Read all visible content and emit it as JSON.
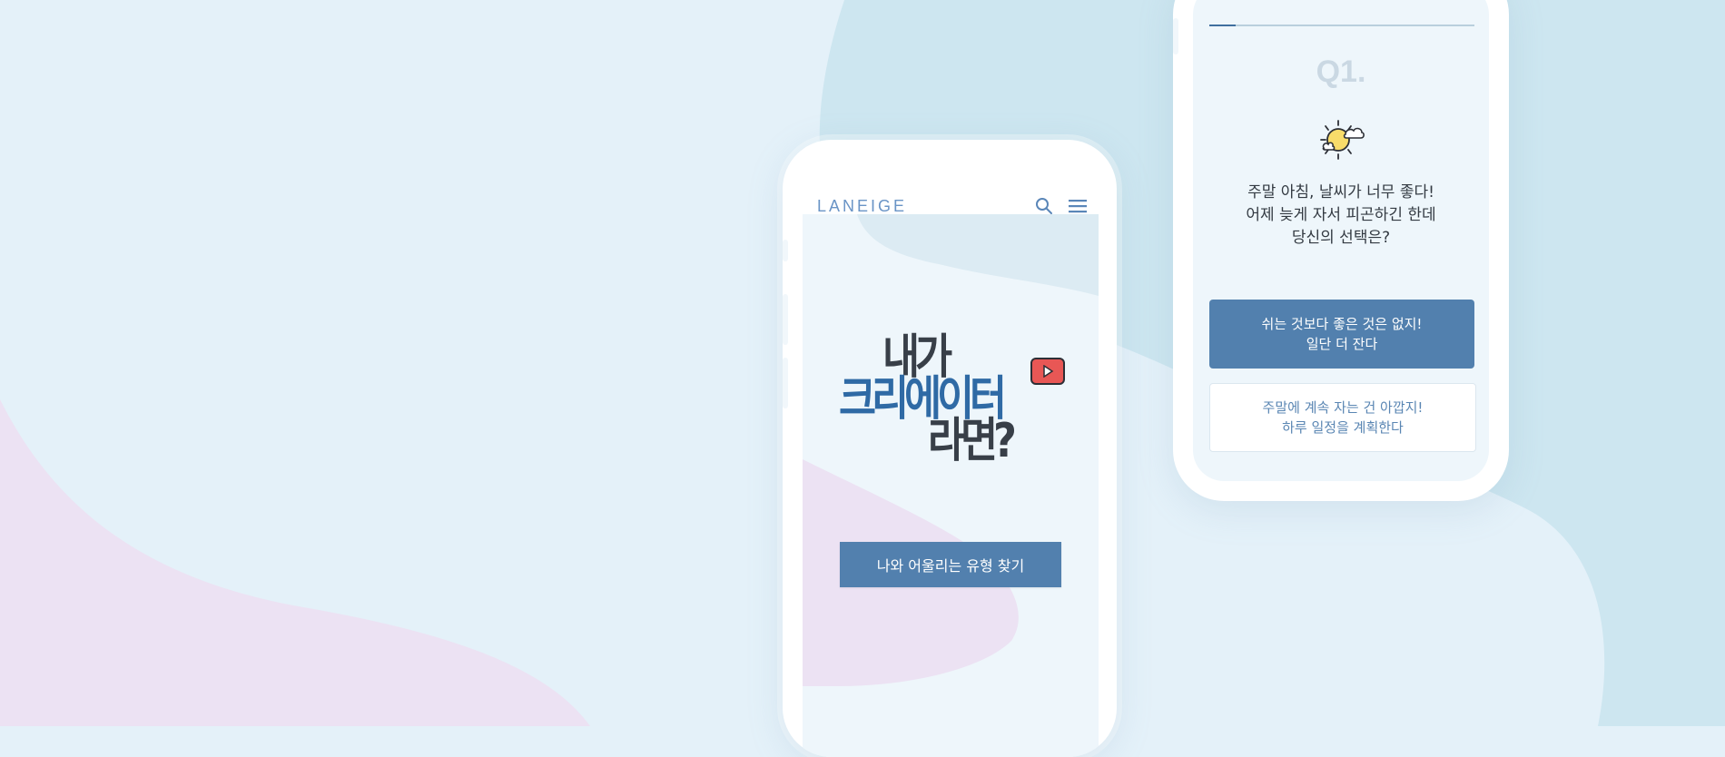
{
  "colors": {
    "background": "#e4f1f9",
    "blob_blue": "#cde6f0",
    "blob_pink": "#ece2f3",
    "accent": "#5280ae",
    "title_dark": "#383f48",
    "title_blue": "#2f6aa5"
  },
  "phone_intro": {
    "logo": "LANEIGE",
    "icons": [
      "search-icon",
      "menu-icon",
      "play-icon"
    ],
    "title_lines": [
      "내가",
      "크리에이터",
      "라면?"
    ],
    "cta_label": "나와 어울리는 유형 찾기"
  },
  "phone_quiz": {
    "progress": 0.1,
    "question_number": "Q1.",
    "icon": "sun-cloud-icon",
    "question_lines": [
      "주말 아침, 날씨가 너무 좋다!",
      "어제 늦게 자서 피곤하긴 한데",
      "당신의 선택은?"
    ],
    "answers": [
      {
        "lines": [
          "쉬는 것보다 좋은 것은 없지!",
          "일단 더 잔다"
        ]
      },
      {
        "lines": [
          "주말에 계속 자는 건 아깝지!",
          "하루 일정을 계획한다"
        ]
      }
    ]
  }
}
